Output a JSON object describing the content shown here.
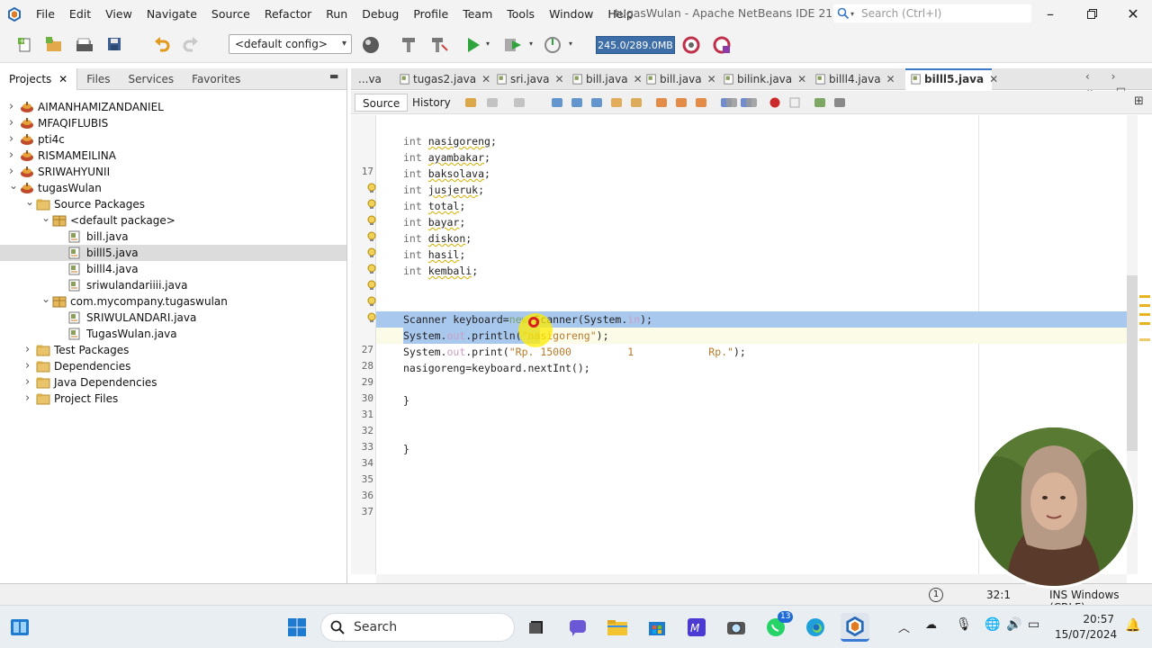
{
  "window": {
    "title": "tugasWulan - Apache NetBeans IDE 21",
    "search_placeholder": "Search (Ctrl+I)"
  },
  "menu": [
    "File",
    "Edit",
    "View",
    "Navigate",
    "Source",
    "Refactor",
    "Run",
    "Debug",
    "Profile",
    "Team",
    "Tools",
    "Window",
    "Help"
  ],
  "toolbar": {
    "config": "<default config>",
    "memory": "245.0/289.0MB"
  },
  "projects_panel": {
    "tabs": [
      "Projects",
      "Files",
      "Services",
      "Favorites"
    ],
    "tree": [
      {
        "label": "AIMANHAMIZANDANIEL",
        "level": 0,
        "type": "project",
        "state": "collapsed"
      },
      {
        "label": "MFAQIFLUBIS",
        "level": 0,
        "type": "project",
        "state": "collapsed"
      },
      {
        "label": "pti4c",
        "level": 0,
        "type": "project",
        "state": "collapsed"
      },
      {
        "label": "RISMAMEILINA",
        "level": 0,
        "type": "project",
        "state": "collapsed"
      },
      {
        "label": "SRIWAHYUNII",
        "level": 0,
        "type": "project",
        "state": "collapsed"
      },
      {
        "label": "tugasWulan",
        "level": 0,
        "type": "project",
        "state": "expanded"
      },
      {
        "label": "Source Packages",
        "level": 1,
        "type": "folder",
        "state": "expanded"
      },
      {
        "label": "<default package>",
        "level": 2,
        "type": "package",
        "state": "expanded"
      },
      {
        "label": "bill.java",
        "level": 3,
        "type": "java",
        "state": "leaf"
      },
      {
        "label": "billl5.java",
        "level": 3,
        "type": "java",
        "state": "leaf",
        "selected": true
      },
      {
        "label": "billl4.java",
        "level": 3,
        "type": "java",
        "state": "leaf"
      },
      {
        "label": "sriwulandariiii.java",
        "level": 3,
        "type": "java",
        "state": "leaf"
      },
      {
        "label": "com.mycompany.tugaswulan",
        "level": 2,
        "type": "package",
        "state": "expanded"
      },
      {
        "label": "SRIWULANDARI.java",
        "level": 3,
        "type": "java",
        "state": "leaf"
      },
      {
        "label": "TugasWulan.java",
        "level": 3,
        "type": "java",
        "state": "leaf"
      },
      {
        "label": "Test Packages",
        "level": 1,
        "type": "folder",
        "state": "collapsed"
      },
      {
        "label": "Dependencies",
        "level": 1,
        "type": "folder",
        "state": "collapsed"
      },
      {
        "label": "Java Dependencies",
        "level": 1,
        "type": "folder",
        "state": "collapsed"
      },
      {
        "label": "Project Files",
        "level": 1,
        "type": "folder",
        "state": "collapsed"
      }
    ]
  },
  "editor": {
    "tabs": [
      "...va",
      "tugas2.java",
      "sri.java",
      "bill.java",
      "bill.java",
      "bilink.java",
      "billl4.java",
      "billl5.java"
    ],
    "active_tab": "billl5.java",
    "views": [
      "Source",
      "History"
    ],
    "lines": [
      {
        "n": "17",
        "text": ""
      },
      {
        "n": "",
        "text": "int nasigoreng;"
      },
      {
        "n": "",
        "text": "int ayambakar;"
      },
      {
        "n": "",
        "text": "int baksolava;"
      },
      {
        "n": "",
        "text": "int jusjeruk;"
      },
      {
        "n": "",
        "text": "int total;"
      },
      {
        "n": "",
        "text": "int bayar;"
      },
      {
        "n": "",
        "text": "int diskon;"
      },
      {
        "n": "",
        "text": "int hasil;"
      },
      {
        "n": "",
        "text": "int kembali;"
      },
      {
        "n": "",
        "text": ""
      },
      {
        "n": "27",
        "text": ""
      },
      {
        "n": "28",
        "text": "Scanner keyboard=new Scanner(System.in);"
      },
      {
        "n": "29",
        "text": "System.out.println(\"nasigoreng\");"
      },
      {
        "n": "30",
        "text": "System.out.print(\"Rp. 15000         1            Rp.\");"
      },
      {
        "n": "31",
        "text": "nasigoreng=keyboard.nextInt();"
      },
      {
        "n": "32",
        "text": ""
      },
      {
        "n": "33",
        "text": "}"
      },
      {
        "n": "34",
        "text": ""
      },
      {
        "n": "35",
        "text": ""
      },
      {
        "n": "36",
        "text": "}"
      },
      {
        "n": "37",
        "text": ""
      }
    ]
  },
  "status": {
    "notifications": "1",
    "position": "32:1",
    "mode": "INS Windows (CRLF)"
  },
  "taskbar": {
    "search_label": "Search",
    "whatsapp_badge": "13",
    "time": "20:57",
    "date": "15/07/2024"
  }
}
